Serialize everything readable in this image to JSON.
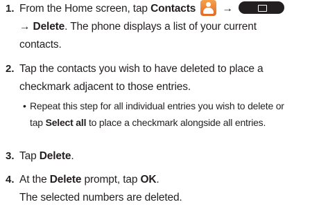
{
  "steps": [
    {
      "number": "1.",
      "line1_pre": "From the Home screen, tap ",
      "line1_contacts": "Contacts",
      "line2_arrow": "→",
      "line2_delete": "Delete",
      "line2_post": ". The phone displays a list of your current",
      "line3": "contacts."
    },
    {
      "number": "2.",
      "line1": "Tap the contacts you wish to have deleted to place a",
      "line2": "checkmark adjacent to those entries.",
      "sub_bullet": "•",
      "sub_line1": "Repeat this step for all individual entries you wish to delete or",
      "sub_line2_pre": "tap ",
      "sub_line2_bold": "Select all",
      "sub_line2_post": " to place a checkmark alongside all entries."
    },
    {
      "number": "3.",
      "pre": "Tap ",
      "bold": "Delete",
      "post": "."
    },
    {
      "number": "4.",
      "pre": "At the ",
      "bold1": "Delete",
      "mid": " prompt, tap ",
      "bold2": "OK",
      "post": ".",
      "line2": "The selected numbers are deleted."
    }
  ],
  "icons": {
    "contacts": "contacts-app-icon",
    "menu": "menu-key-icon",
    "arrow": "→"
  },
  "colors": {
    "text": "#231f20",
    "contacts_icon": "#e97a30",
    "menu_key": "#231f20"
  }
}
